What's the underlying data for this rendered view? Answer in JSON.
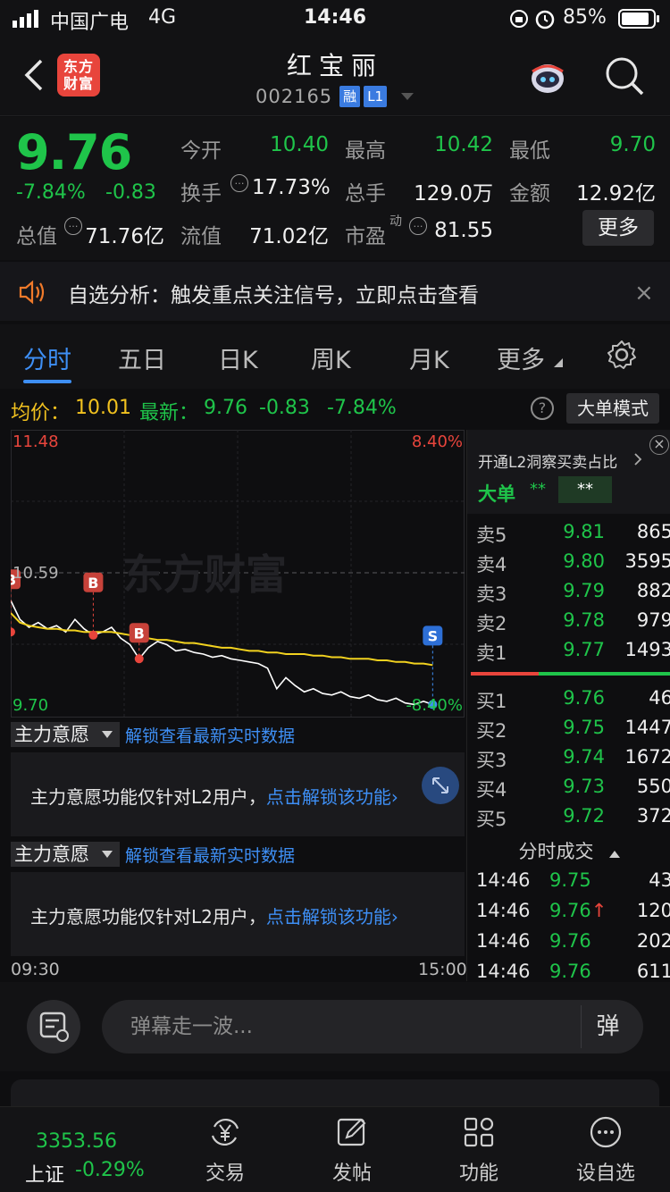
{
  "status_bar": {
    "carrier": "中国广电",
    "network": "4G",
    "time": "14:46",
    "battery": "85%"
  },
  "header": {
    "brand_line1": "东方",
    "brand_line2": "财富",
    "stock_name": "红宝丽",
    "stock_code": "002165",
    "badge_rong": "融",
    "badge_level": "L1"
  },
  "quote": {
    "price": "9.76",
    "change_pct": "-7.84%",
    "change": "-0.83",
    "open_label": "今开",
    "open": "10.40",
    "high_label": "最高",
    "high": "10.42",
    "low_label": "最低",
    "low": "9.70",
    "turnover_label": "换手",
    "turnover": "17.73%",
    "volume_label": "总手",
    "volume": "129.0万",
    "amount_label": "金额",
    "amount": "12.92亿",
    "mktcap_label": "总值",
    "mktcap": "71.76亿",
    "float_label": "流值",
    "float": "71.02亿",
    "pe_label": "市盈",
    "pe_sup": "动",
    "pe": "81.55",
    "more_label": "更多"
  },
  "notice": {
    "text": "自选分析：触发重点关注信号，立即点击查看",
    "close": "×"
  },
  "tabs": [
    {
      "label": "分时",
      "active": true
    },
    {
      "label": "五日"
    },
    {
      "label": "日K"
    },
    {
      "label": "周K"
    },
    {
      "label": "月K"
    },
    {
      "label": "更多"
    }
  ],
  "avg_row": {
    "avg_label": "均价：",
    "avg_value": "10.01",
    "latest_label": "最新：",
    "latest_value": "9.76",
    "latest_change": "-0.83",
    "latest_pct": "-7.84%",
    "help": "?",
    "big_order_mode": "大单模式"
  },
  "chart_data": {
    "type": "line",
    "y_top_label": "11.48",
    "y_mid_label": "10.59",
    "y_bottom_label": "9.70",
    "pct_top_label": "8.40%",
    "pct_bottom_label": "-8.40%",
    "ylim": [
      9.7,
      11.48
    ],
    "x_start_label": "09:30",
    "x_end_label": "15:00",
    "watermark": "东方财富",
    "series": [
      {
        "role": "price",
        "color": "#ffffff",
        "values": [
          10.42,
          10.3,
          10.25,
          10.28,
          10.24,
          10.26,
          10.22,
          10.3,
          10.24,
          10.2,
          10.22,
          10.25,
          10.18,
          10.14,
          10.05,
          10.12,
          10.16,
          10.14,
          10.1,
          10.11,
          10.09,
          10.08,
          10.06,
          10.07,
          10.05,
          10.04,
          10.03,
          10.02,
          9.99,
          9.86,
          9.93,
          9.88,
          9.84,
          9.86,
          9.83,
          9.82,
          9.84,
          9.81,
          9.8,
          9.82,
          9.79,
          9.78,
          9.8,
          9.77,
          9.76,
          9.78,
          9.76
        ]
      },
      {
        "role": "average",
        "color": "#f2d21f",
        "values": [
          10.34,
          10.28,
          10.26,
          10.25,
          10.24,
          10.24,
          10.23,
          10.23,
          10.22,
          10.22,
          10.22,
          10.22,
          10.21,
          10.2,
          10.19,
          10.18,
          10.17,
          10.17,
          10.16,
          10.15,
          10.15,
          10.14,
          10.13,
          10.12,
          10.12,
          10.11,
          10.1,
          10.1,
          10.09,
          10.09,
          10.08,
          10.08,
          10.08,
          10.07,
          10.07,
          10.06,
          10.06,
          10.05,
          10.05,
          10.05,
          10.04,
          10.04,
          10.03,
          10.03,
          10.02,
          10.02,
          10.01
        ]
      }
    ],
    "markers": [
      {
        "label": "B",
        "index": 0,
        "value": 10.22
      },
      {
        "label": "B",
        "index": 9,
        "value": 10.2
      },
      {
        "label": "B",
        "index": 14,
        "value": 10.05
      },
      {
        "label": "S",
        "index": 46,
        "value": 9.76
      }
    ]
  },
  "order_book": {
    "l2_promo": "开通L2洞察买卖占比",
    "big_order_label": "大单",
    "big_order_buy": "**",
    "big_order_sell": "**",
    "sell": [
      {
        "label": "卖5",
        "price": "9.81",
        "vol": "865"
      },
      {
        "label": "卖4",
        "price": "9.80",
        "vol": "3595"
      },
      {
        "label": "卖3",
        "price": "9.79",
        "vol": "882"
      },
      {
        "label": "卖2",
        "price": "9.78",
        "vol": "979"
      },
      {
        "label": "卖1",
        "price": "9.77",
        "vol": "1493"
      }
    ],
    "buy": [
      {
        "label": "买1",
        "price": "9.76",
        "vol": "46"
      },
      {
        "label": "买2",
        "price": "9.75",
        "vol": "1447"
      },
      {
        "label": "买3",
        "price": "9.74",
        "vol": "1672"
      },
      {
        "label": "买4",
        "price": "9.73",
        "vol": "550"
      },
      {
        "label": "买5",
        "price": "9.72",
        "vol": "372"
      }
    ],
    "trades_title": "分时成交",
    "trades": [
      {
        "time": "14:46",
        "price": "9.75",
        "vol": "43"
      },
      {
        "time": "14:46",
        "price": "9.76",
        "vol": "120",
        "arrow": "↑"
      },
      {
        "time": "14:46",
        "price": "9.76",
        "vol": "202"
      },
      {
        "time": "14:46",
        "price": "9.76",
        "vol": "611"
      }
    ]
  },
  "panels": [
    {
      "button": "主力意愿",
      "link": "解锁查看最新实时数据",
      "text": "主力意愿功能仅针对L2用户，",
      "unlock": "点击解锁该功能"
    },
    {
      "button": "主力意愿",
      "link": "解锁查看最新实时数据",
      "text": "主力意愿功能仅针对L2用户，",
      "unlock": "点击解锁该功能"
    }
  ],
  "comment_bar": {
    "placeholder": "弹幕走一波...",
    "danmu_label": "弹"
  },
  "bottom_nav": {
    "index_value": "3353.56",
    "index_name": "上证",
    "index_change": "-0.29%",
    "items": [
      {
        "label": "交易"
      },
      {
        "label": "发帖"
      },
      {
        "label": "功能"
      },
      {
        "label": "设自选"
      }
    ]
  }
}
